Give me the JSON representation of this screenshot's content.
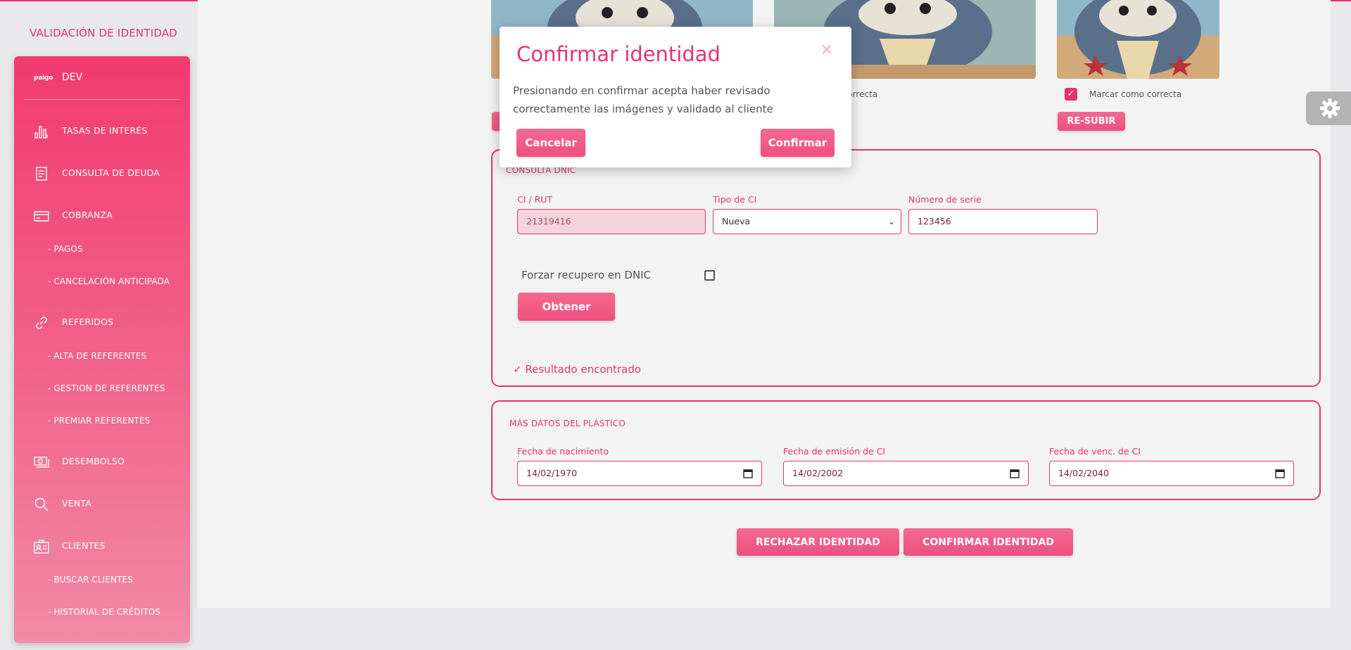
{
  "sidebar": {
    "brand_title": "VALIDACIÓN DE IDENTIDAD",
    "logo": "paigo",
    "user": "DEV",
    "items": [
      {
        "label": "TASAS DE INTERÉS",
        "icon": "bar-chart-icon"
      },
      {
        "label": "CONSULTA DE DEUDA",
        "icon": "document-icon"
      },
      {
        "label": "COBRANZA",
        "icon": "credit-card-icon"
      },
      {
        "label": "REFERIDOS",
        "icon": "link-icon"
      },
      {
        "label": "DESEMBOLSO",
        "icon": "money-icon"
      },
      {
        "label": "VENTA",
        "icon": "search-icon"
      },
      {
        "label": "CLIENTES",
        "icon": "id-card-icon"
      }
    ],
    "sub_items": {
      "cobranza": [
        "- PAGOS",
        "- CANCELACIÓN ANTICIPADA"
      ],
      "referidos": [
        "- ALTA DE REFERENTES",
        "- GESTION DE REFERENTES",
        "- PREMIAR REFERENTES"
      ],
      "clientes": [
        "- BUSCAR CLIENTES",
        "- HISTORIAL DE CRÉDITOS"
      ]
    }
  },
  "images": {
    "check_label_2_partial": "no correcta",
    "check_label_3": "Marcar como correcta",
    "resubir": "RE-SUBIR"
  },
  "dnic": {
    "title": "CONSULTA DNIC",
    "ci_label": "CI / RUT",
    "ci_value": "21319416",
    "tipo_label": "Tipo de CI",
    "tipo_value": "Nueva",
    "serie_label": "Número de serie",
    "serie_value": "123456",
    "forzar_label": "Forzar recupero en DNIC",
    "obtener": "Obtener",
    "result": "✓ Resultado encontrado"
  },
  "plastico": {
    "title": "MÁS DATOS DEL PLÁSTICO",
    "nacimiento_label": "Fecha de nacimiento",
    "nacimiento_value": "14/02/1970",
    "emision_label": "Fecha de emisión de CI",
    "emision_value": "14/02/2002",
    "venc_label": "Fecha de venc. de CI",
    "venc_value": "14/02/2040"
  },
  "actions": {
    "reject": "RECHAZAR IDENTIDAD",
    "confirm": "CONFIRMAR IDENTIDAD"
  },
  "modal": {
    "title": "Confirmar identidad",
    "close": "×",
    "body": "Presionando en confirmar acepta haber revisado correctamente las imágenes y validado al cliente",
    "cancel": "Cancelar",
    "confirm": "Confirmar"
  },
  "colors": {
    "accent": "#e8336d",
    "sidebar_top": "#f23a6e",
    "sidebar_bottom": "#f38aa7"
  }
}
